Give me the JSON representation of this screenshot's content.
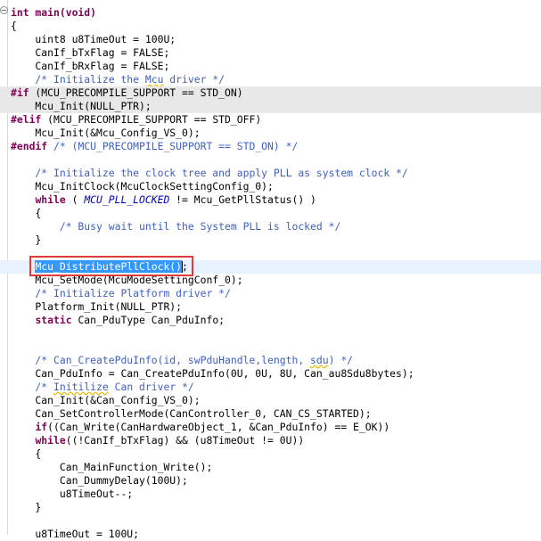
{
  "editor": {
    "language": "c",
    "lines": [
      {
        "tokens": [
          {
            "t": "int main(void)",
            "c": "kw"
          }
        ]
      },
      {
        "tokens": [
          {
            "t": "{"
          }
        ]
      },
      {
        "tokens": [
          {
            "t": "    uint8 u8TimeOut = 100U;"
          }
        ]
      },
      {
        "tokens": [
          {
            "t": "    CanIf_bTxFlag = FALSE;"
          }
        ]
      },
      {
        "tokens": [
          {
            "t": "    CanIf_bRxFlag = FALSE;"
          }
        ]
      },
      {
        "tokens": [
          {
            "t": "    /* Initialize the ",
            "c": "cm"
          },
          {
            "t": "Mcu",
            "c": "cm sq"
          },
          {
            "t": " driver */",
            "c": "cm"
          }
        ]
      },
      {
        "bg": "disabled",
        "tokens": [
          {
            "t": "#if",
            "c": "kw"
          },
          {
            "t": " (MCU_PRECOMPILE_SUPPORT == STD_ON)"
          }
        ]
      },
      {
        "bg": "disabled",
        "tokens": [
          {
            "t": "    Mcu_Init(NULL_PTR);"
          }
        ]
      },
      {
        "tokens": [
          {
            "t": "#elif",
            "c": "kw"
          },
          {
            "t": " (MCU_PRECOMPILE_SUPPORT == STD_OFF)"
          }
        ]
      },
      {
        "tokens": [
          {
            "t": "    Mcu_Init(&Mcu_Config_VS_0);"
          }
        ]
      },
      {
        "tokens": [
          {
            "t": "#endif",
            "c": "kw"
          },
          {
            "t": " /* (MCU_PRECOMPILE_SUPPORT == STD_ON) */",
            "c": "cm"
          }
        ]
      },
      {
        "tokens": [
          {
            "t": ""
          }
        ]
      },
      {
        "tokens": [
          {
            "t": "    /* Initialize the clock tree and apply PLL as system clock */",
            "c": "cm"
          }
        ]
      },
      {
        "tokens": [
          {
            "t": "    Mcu_InitClock(McuClockSettingConfig_0);"
          }
        ]
      },
      {
        "tokens": [
          {
            "t": "    "
          },
          {
            "t": "while",
            "c": "kw"
          },
          {
            "t": " ( "
          },
          {
            "t": "MCU_PLL_LOCKED",
            "c": "it"
          },
          {
            "t": " != Mcu_GetPllStatus() )"
          }
        ]
      },
      {
        "tokens": [
          {
            "t": "    {"
          }
        ]
      },
      {
        "tokens": [
          {
            "t": "        /* Busy wait until the System PLL is locked */",
            "c": "cm"
          }
        ]
      },
      {
        "tokens": [
          {
            "t": "    }"
          }
        ]
      },
      {
        "tokens": [
          {
            "t": ""
          }
        ]
      },
      {
        "bg": "current",
        "tokens": [
          {
            "t": "    "
          },
          {
            "t": "Mcu_DistributePllClock()",
            "c": "sel"
          },
          {
            "t": "",
            "c": "caret"
          },
          {
            "t": ";"
          }
        ]
      },
      {
        "tokens": [
          {
            "t": "    Mcu_SetMode(McuModeSettingConf_0);"
          }
        ]
      },
      {
        "tokens": [
          {
            "t": "    /* Initialize Platform driver */",
            "c": "cm"
          }
        ]
      },
      {
        "tokens": [
          {
            "t": "    Platform_Init(NULL_PTR);"
          }
        ]
      },
      {
        "tokens": [
          {
            "t": "    "
          },
          {
            "t": "static",
            "c": "kw"
          },
          {
            "t": " Can_PduType Can_PduInfo;"
          }
        ]
      },
      {
        "tokens": [
          {
            "t": ""
          }
        ]
      },
      {
        "tokens": [
          {
            "t": ""
          }
        ]
      },
      {
        "tokens": [
          {
            "t": "    /* Can_CreatePduInfo(id, swPduHandle,length, ",
            "c": "cm"
          },
          {
            "t": "sdu",
            "c": "cm sq"
          },
          {
            "t": ") */",
            "c": "cm"
          }
        ]
      },
      {
        "tokens": [
          {
            "t": "    Can_PduInfo = Can_CreatePduInfo(0U, 0U, 8U, Can_au8Sdu8bytes);"
          }
        ]
      },
      {
        "tokens": [
          {
            "t": "    /* ",
            "c": "cm"
          },
          {
            "t": "Initilize",
            "c": "cm sq"
          },
          {
            "t": " Can driver */",
            "c": "cm"
          }
        ]
      },
      {
        "tokens": [
          {
            "t": "    Can_Init(&Can_Config_VS_0);"
          }
        ]
      },
      {
        "tokens": [
          {
            "t": "    Can_SetControllerMode(CanController_0, CAN_CS_STARTED);"
          }
        ]
      },
      {
        "tokens": [
          {
            "t": "    "
          },
          {
            "t": "if",
            "c": "kw"
          },
          {
            "t": "((Can_Write(CanHardwareObject_1, &Can_PduInfo) == E_OK))"
          }
        ]
      },
      {
        "tokens": [
          {
            "t": "    "
          },
          {
            "t": "while",
            "c": "kw"
          },
          {
            "t": "((!CanIf_bTxFlag) && (u8TimeOut != 0U))"
          }
        ]
      },
      {
        "tokens": [
          {
            "t": "    {"
          }
        ]
      },
      {
        "tokens": [
          {
            "t": "        Can_MainFunction_Write();"
          }
        ]
      },
      {
        "tokens": [
          {
            "t": "        Can_DummyDelay(100U);"
          }
        ]
      },
      {
        "tokens": [
          {
            "t": "        u8TimeOut--;"
          }
        ]
      },
      {
        "tokens": [
          {
            "t": "    }"
          }
        ]
      },
      {
        "tokens": [
          {
            "t": ""
          }
        ]
      },
      {
        "tokens": [
          {
            "t": "    u8TimeOut = 100U;"
          }
        ]
      }
    ]
  }
}
